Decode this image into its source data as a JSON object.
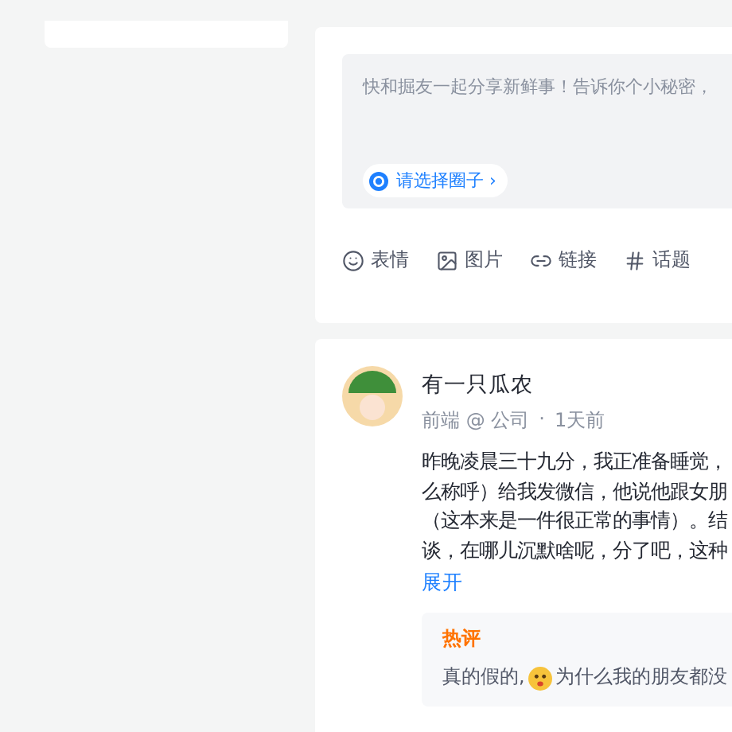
{
  "composer": {
    "placeholder": "快和掘友一起分享新鲜事！告诉你个小秘密，",
    "circle_picker": {
      "label": "请选择圈子",
      "caret": "›"
    },
    "tools": [
      {
        "kind": "emoji",
        "label": "表情"
      },
      {
        "kind": "image",
        "label": "图片"
      },
      {
        "kind": "link",
        "label": "链接"
      },
      {
        "kind": "topic",
        "label": "话题"
      }
    ]
  },
  "post": {
    "author": "有一只瓜农",
    "meta": [
      "前端 @ 公司",
      "·",
      "1天前"
    ],
    "body": [
      "昨晚凌晨三十九分，我正准备睡觉，",
      "么称呼）给我发微信，他说他跟女朋",
      "（这本来是一件很正常的事情）。结",
      "谈，在哪儿沉默啥呢，分了吧，这种"
    ],
    "expand": "展开",
    "hot_comment": {
      "badge": "热评",
      "text_before": "真的假的,",
      "text_after": "为什么我的朋友都没"
    }
  }
}
